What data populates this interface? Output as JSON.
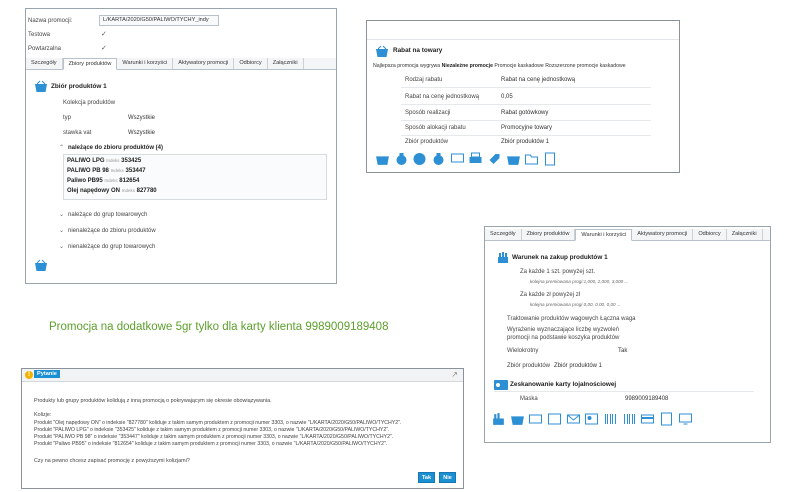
{
  "panel1": {
    "fields": {
      "nazwa_label": "Nazwa promocji:",
      "nazwa_value": "L/KARTA/2020/G50/PALIWO/TYCHY_indy",
      "testowa_label": "Testowa",
      "powtarzalna_label": "Powtarzalna"
    },
    "tabs": [
      "Szczegóły",
      "Zbiory produktów",
      "Warunki i korzyści",
      "Aktywatory promocji",
      "Odbiorcy",
      "Załączniki"
    ],
    "section_title": "Zbiór produktów 1",
    "kolekcja_label": "Kolekcja produktów",
    "typ_label": "typ",
    "typ_value": "Wszystkie",
    "stawka_label": "stawka vat",
    "stawka_value": "Wszystkie",
    "group_title": "należące do zbioru produktów (4)",
    "products": [
      {
        "name": "PALIWO LPG",
        "idx_label": "Indeks",
        "idx": "353425"
      },
      {
        "name": "PALIWO PB 98",
        "idx_label": "Indeks",
        "idx": "353447"
      },
      {
        "name": "Paliwo PB95",
        "idx_label": "Indeks",
        "idx": "812654"
      },
      {
        "name": "Olej napędowy ON",
        "idx_label": "Indeks",
        "idx": "827780"
      }
    ],
    "collapsed": [
      "należące do grup towarowych",
      "nienależące do zbioru produktów",
      "nienależące do grup towarowych"
    ]
  },
  "panel2": {
    "title": "Rabat na towary",
    "types": [
      "Najlepsza promocja wygrywa",
      "Niezależne promocje",
      "Promocje kaskadowe",
      "Rozszerzone promocje kaskadowe"
    ],
    "rows": [
      {
        "label": "Rodzaj rabatu",
        "value": "Rabat na cenę jednostkową"
      },
      {
        "label": "Rabat na cenę jednostkową",
        "value": "0,05"
      },
      {
        "label": "Sposób realizacji",
        "value": "Rabat gotówkowy"
      },
      {
        "label": "Sposób alokacji rabatu",
        "value": "Promocyjne towary"
      },
      {
        "label": "Zbiór produktów",
        "value": "Zbiór produktów 1"
      }
    ]
  },
  "panel3": {
    "tabs": [
      "Szczegóły",
      "Zbiory produktów",
      "Warunki i korzyści",
      "Aktywatory promocji",
      "Odbiorcy",
      "Załączniki"
    ],
    "title": "Warunek na zakup produktów 1",
    "line1": "Za każde 1 szt. powyżej szt.",
    "line1_sub": "kolejna premiowana progi:1,000, 2,000, 3,000 ...",
    "line2": "Za każde zł powyżej zł",
    "line2_sub": "kolejna premiowana progi 0,00, 0,00, 0,00 ...",
    "traktowanie": "Traktowanie produktów wagowych  Łączna waga",
    "wyrazenie1": "Wyrażenie wyznaczające liczbę wyzwoleń",
    "wyrazenie2": "promocji na podstawie koszyka produktów",
    "wielokrotny_label": "Wielokrotny",
    "wielokrotny_value": "Tak",
    "zbior_label": "Zbiór produktów",
    "zbior_value": "Zbiór produktów 1",
    "scan_title": "Zeskanowanie karty lojalnościowej",
    "maska_label": "Maska",
    "maska_value": "9989009189408"
  },
  "promo_text": "Promocja na dodatkowe 5gr tylko dla karty klienta 9989009189408",
  "dialog": {
    "title": "Pytanie",
    "intro": "Produkty lub grupy produktów kolidują z inną promocją o pokrywającym się okresie obowiązywania.",
    "kolizje": "Kolizje:",
    "lines": [
      "Produkt \"Olej napędowy ON\" o indeksie \"827780\" koliduje z takim samym produktem z promocji numer 3303, o nazwie \"L/KARTA/2020/G50/PALIWO/TYCHY2\".",
      "Produkt \"PALIWO LPG\" o indeksie \"353425\" koliduje z takim samym produktem z promocji numer 3303, o nazwie \"L/KARTA/2020/G50/PALIWO/TYCHY2\".",
      "Produkt \"PALIWO PB 98\" o indeksie \"353447\" koliduje z takim samym produktem z promocji numer 3303, o nazwie \"L/KARTA/2020/G50/PALIWO/TYCHY2\".",
      "Produkt \"Paliwo PB95\" o indeksie \"812654\" koliduje z takim samym produktem z promocji numer 3303, o nazwie \"L/KARTA/2020/G50/PALIWO/TYCHY2\"."
    ],
    "question": "Czy na pewno chcesz zapisać promocję z powyższymi kolizjami?",
    "yes": "Tak",
    "no": "Nie"
  }
}
